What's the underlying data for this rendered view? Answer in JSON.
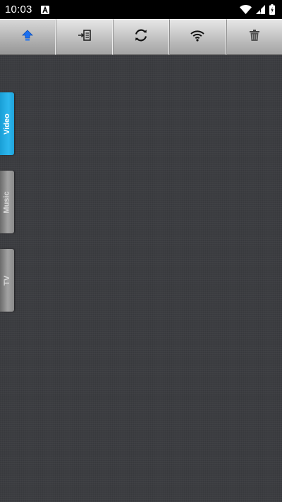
{
  "status_bar": {
    "time": "10:03",
    "icons": [
      "notification-a-icon",
      "wifi-icon",
      "signal-icon",
      "battery-icon"
    ]
  },
  "toolbar": {
    "buttons": [
      {
        "name": "upload-button",
        "icon": "upload-arrow-icon",
        "active": true
      },
      {
        "name": "import-button",
        "icon": "import-icon",
        "active": false
      },
      {
        "name": "refresh-button",
        "icon": "refresh-icon",
        "active": false
      },
      {
        "name": "wifi-button",
        "icon": "wifi-icon",
        "active": false
      },
      {
        "name": "delete-button",
        "icon": "trash-icon",
        "active": false
      }
    ]
  },
  "side_tabs": [
    {
      "label": "Video",
      "active": true
    },
    {
      "label": "Music",
      "active": false
    },
    {
      "label": "TV",
      "active": false
    }
  ],
  "colors": {
    "accent": "#2ab0e8",
    "background": "#3c3d41",
    "status_bar": "#000000",
    "upload_icon": "#1a6ff0"
  }
}
